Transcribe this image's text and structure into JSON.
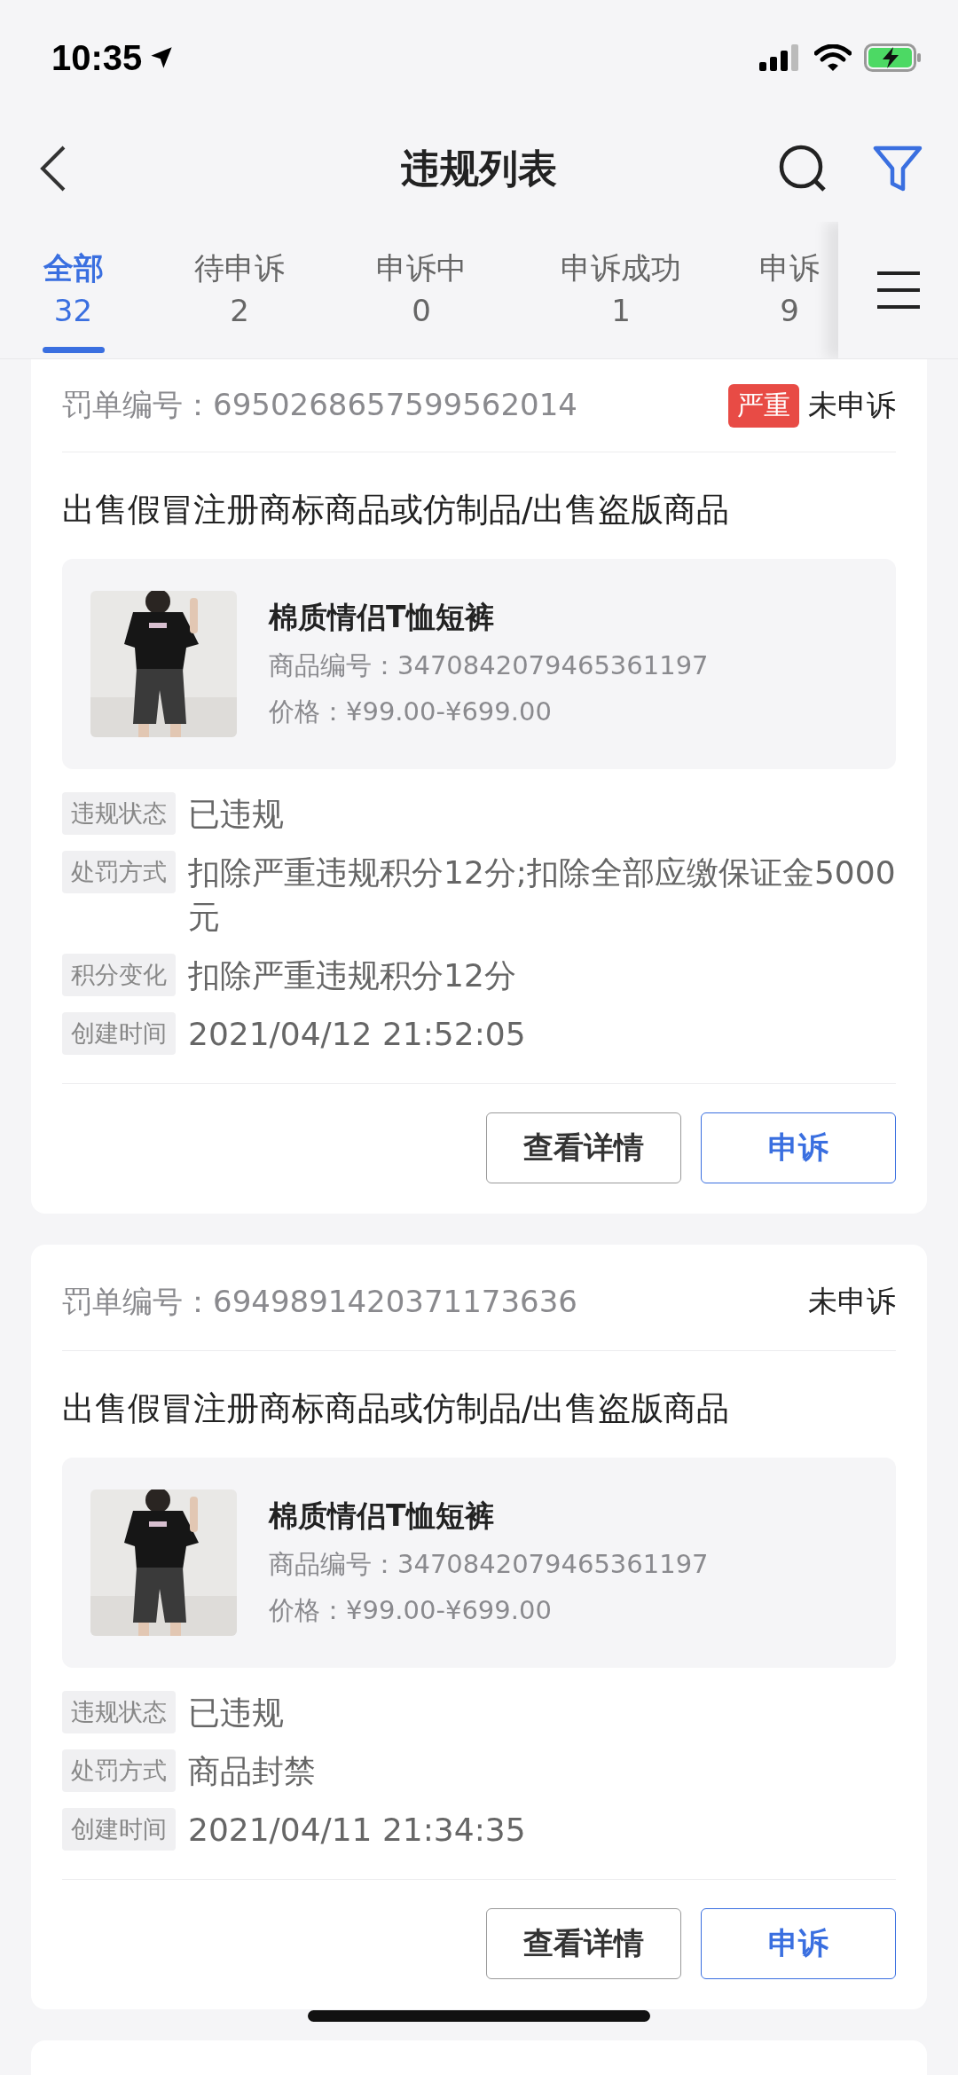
{
  "status_bar": {
    "time": "10:35"
  },
  "nav": {
    "title": "违规列表"
  },
  "tabs": [
    {
      "label": "全部",
      "count": "32",
      "selected": true
    },
    {
      "label": "待申诉",
      "count": "2",
      "selected": false
    },
    {
      "label": "申诉中",
      "count": "0",
      "selected": false
    },
    {
      "label": "申诉成功",
      "count": "1",
      "selected": false
    },
    {
      "label": "申诉",
      "count": "9",
      "selected": false
    }
  ],
  "cards": [
    {
      "ticket_label": "罚单编号：",
      "ticket_no": "6950268657599562014",
      "tag": "严重",
      "status": "未申诉",
      "title": "出售假冒注册商标商品或仿制品/出售盗版商品",
      "product": {
        "name": "棉质情侣T恤短裤",
        "code": "商品编号：3470842079465361197",
        "price": "价格：¥99.00-¥699.00"
      },
      "details": [
        {
          "label": "违规状态",
          "value": "已违规"
        },
        {
          "label": "处罚方式",
          "value": "扣除严重违规积分12分;扣除全部应缴保证金5000元"
        },
        {
          "label": "积分变化",
          "value": "扣除严重违规积分12分"
        },
        {
          "label": "创建时间",
          "value": "2021/04/12 21:52:05"
        }
      ],
      "buttons": [
        {
          "label": "查看详情",
          "kind": "secondary"
        },
        {
          "label": "申诉",
          "kind": "primary"
        }
      ]
    },
    {
      "ticket_label": "罚单编号：",
      "ticket_no": "6949891420371173636",
      "status": "未申诉",
      "title": "出售假冒注册商标商品或仿制品/出售盗版商品",
      "product": {
        "name": "棉质情侣T恤短裤",
        "code": "商品编号：3470842079465361197",
        "price": "价格：¥99.00-¥699.00"
      },
      "details": [
        {
          "label": "违规状态",
          "value": "已违规"
        },
        {
          "label": "处罚方式",
          "value": "商品封禁"
        },
        {
          "label": "创建时间",
          "value": "2021/04/11 21:34:35"
        }
      ],
      "buttons": [
        {
          "label": "查看详情",
          "kind": "secondary"
        },
        {
          "label": "申诉",
          "kind": "primary"
        }
      ]
    }
  ]
}
